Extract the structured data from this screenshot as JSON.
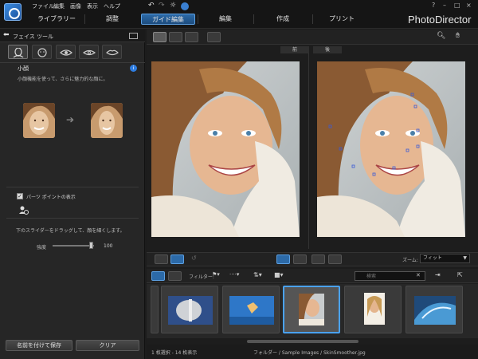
{
  "menu": [
    "ファイル",
    "編集",
    "画像",
    "表示",
    "ヘルプ"
  ],
  "tabs": [
    "ライブラリー",
    "調整",
    "ガイド編集",
    "編集",
    "作成",
    "プリント"
  ],
  "brand": "PhotoDirector",
  "window_controls": [
    "?",
    "–",
    "□",
    "×"
  ],
  "left_panel": {
    "title": "フェイス ツール",
    "feature_title": "小顔",
    "feature_desc": "小顔機能を使って、さらに魅力的な顔に。",
    "info": "i",
    "checkbox_label": "パーツ ポイントの表示",
    "checkbox_mark": "✓",
    "slider_help": "下のスライダーをドラッグして、顔を細くします。",
    "strength_label": "強度",
    "strength_value": "100",
    "strength": 1.0,
    "save_as": "名前を付けて保存",
    "clear": "クリア"
  },
  "viewer": {
    "before": "前",
    "after": "後"
  },
  "compare": {
    "zoom_label": "ズーム:",
    "zoom_value": "フィット"
  },
  "browser": {
    "filter_label": "フィルター:",
    "search_placeholder": "検索"
  },
  "status": {
    "count": "1 枚選択 - 14 枚表示",
    "path": "フォルダー / Sample Images / SkinSmoother.jpg"
  }
}
